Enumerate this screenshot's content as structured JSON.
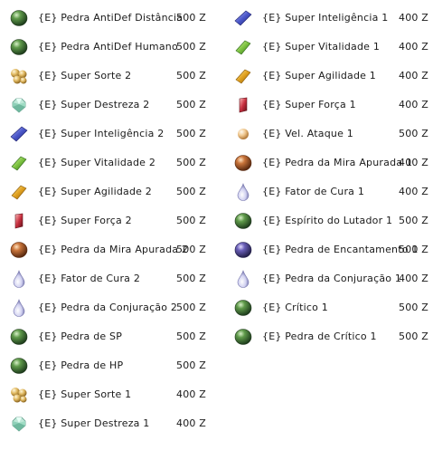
{
  "shop": {
    "left_items": [
      {
        "name": "{E} Pedra AntiDef Distância",
        "price": "500 Z",
        "icon": "green-stone-icon"
      },
      {
        "name": "{E} Pedra AntiDef Humano",
        "price": "500 Z",
        "icon": "green-stone-icon"
      },
      {
        "name": "{E} Super Sorte 2",
        "price": "500 Z",
        "icon": "gold-nuggets-icon"
      },
      {
        "name": "{E} Super Destreza 2",
        "price": "500 Z",
        "icon": "emerald-gem-icon"
      },
      {
        "name": "{E} Super Inteligência 2",
        "price": "500 Z",
        "icon": "blue-crystal-icon"
      },
      {
        "name": "{E} Super Vitalidade 2",
        "price": "500 Z",
        "icon": "green-crystal-icon"
      },
      {
        "name": "{E} Super Agilidade 2",
        "price": "500 Z",
        "icon": "yellow-crystal-icon"
      },
      {
        "name": "{E} Super Força 2",
        "price": "500 Z",
        "icon": "red-crystal-icon"
      },
      {
        "name": "{E} Pedra da Mira Apurada 2",
        "price": "500 Z",
        "icon": "orange-stone-icon"
      },
      {
        "name": "{E} Fator de Cura 2",
        "price": "500 Z",
        "icon": "water-drop-icon"
      },
      {
        "name": "{E} Pedra da Conjuração 2",
        "price": "500 Z",
        "icon": "water-drop-icon"
      },
      {
        "name": "{E} Pedra de SP",
        "price": "500 Z",
        "icon": "green-stone-icon"
      },
      {
        "name": "{E} Pedra de HP",
        "price": "500 Z",
        "icon": "green-stone-icon"
      },
      {
        "name": "{E} Super Sorte 1",
        "price": "400 Z",
        "icon": "gold-nuggets-icon"
      },
      {
        "name": "{E} Super Destreza 1",
        "price": "400 Z",
        "icon": "emerald-gem-icon"
      }
    ],
    "right_items": [
      {
        "name": "{E} Super Inteligência 1",
        "price": "400 Z",
        "icon": "blue-crystal-icon"
      },
      {
        "name": "{E} Super Vitalidade 1",
        "price": "400 Z",
        "icon": "green-crystal-icon"
      },
      {
        "name": "{E} Super Agilidade 1",
        "price": "400 Z",
        "icon": "yellow-crystal-icon"
      },
      {
        "name": "{E} Super Força 1",
        "price": "400 Z",
        "icon": "red-crystal-icon"
      },
      {
        "name": "{E} Vel. Ataque 1",
        "price": "500 Z",
        "icon": "small-orb-icon"
      },
      {
        "name": "{E} Pedra da Mira Apurada 1",
        "price": "400 Z",
        "icon": "orange-stone-icon"
      },
      {
        "name": "{E} Fator de Cura 1",
        "price": "400 Z",
        "icon": "water-drop-icon"
      },
      {
        "name": "{E} Espírito do Lutador 1",
        "price": "500 Z",
        "icon": "green-stone-icon"
      },
      {
        "name": "{E} Pedra de Encantamento 1",
        "price": "500 Z",
        "icon": "purple-stone-icon"
      },
      {
        "name": "{E} Pedra da Conjuração 1",
        "price": "400 Z",
        "icon": "water-drop-icon"
      },
      {
        "name": "{E} Crítico 1",
        "price": "500 Z",
        "icon": "green-stone-icon"
      },
      {
        "name": "{E} Pedra de Crítico 1",
        "price": "500 Z",
        "icon": "green-stone-icon"
      }
    ]
  }
}
